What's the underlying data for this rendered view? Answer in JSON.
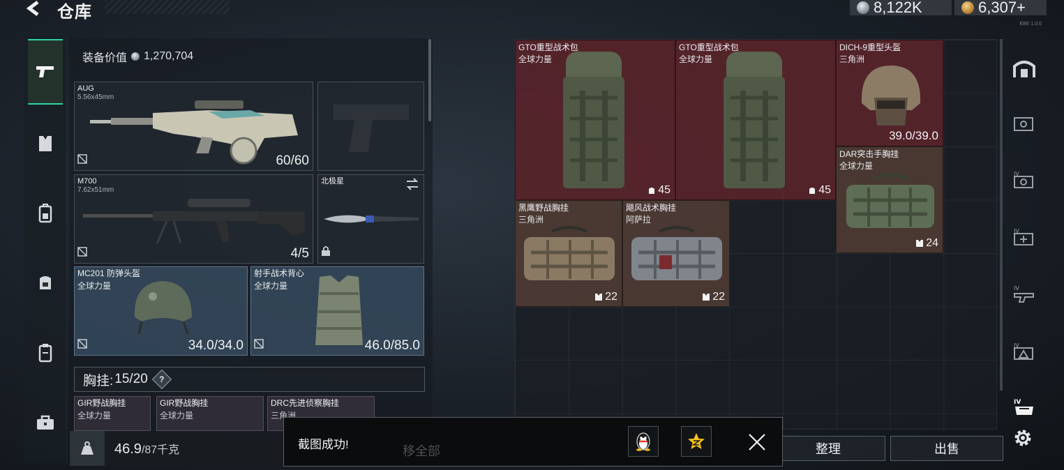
{
  "header": {
    "title": "仓库",
    "currency_silver": "8,122K",
    "currency_gold": "6,307+",
    "build_tag": "EBE 1.0.0"
  },
  "loadout": {
    "equip_value_label": "装备价值",
    "equip_value": "1,270,704",
    "primary": {
      "name": "AUG",
      "caliber": "5.56x45mm",
      "ammo": "60/60"
    },
    "secondary": {
      "name": "M700",
      "caliber": "7.62x51mm",
      "ammo": "4/5"
    },
    "melee": {
      "name": "北极星"
    },
    "helmet": {
      "name": "MC201 防弹头盔",
      "origin": "全球力量",
      "durability": "34.0/34.0"
    },
    "armor": {
      "name": "射手战术背心",
      "origin": "全球力量",
      "durability": "46.0/85.0"
    },
    "rig_label": "胸挂:",
    "rig_capacity": "15/20",
    "rig_help": "?",
    "rig_items": [
      {
        "name": "GIR野战胸挂",
        "origin": "全球力量"
      },
      {
        "name": "GIR野战胸挂",
        "origin": "全球力量"
      },
      {
        "name": "DRC先进侦察胸挂",
        "origin": "三角洲"
      }
    ],
    "weight_current": "46.9",
    "weight_max": "/87千克"
  },
  "stash": {
    "items": [
      {
        "name": "GTO重型战术包",
        "origin": "全球力量",
        "count": "45"
      },
      {
        "name": "GTO重型战术包",
        "origin": "全球力量",
        "count": "45"
      },
      {
        "name": "DICH-9重型头盔",
        "origin": "三角洲",
        "count": "39.0/39.0"
      },
      {
        "name": "DAR突击手胸挂",
        "origin": "全球力量",
        "count": "24"
      },
      {
        "name": "黑鹰野战胸挂",
        "origin": "三角洲",
        "count": "22"
      },
      {
        "name": "飓风战术胸挂",
        "origin": "阿萨拉",
        "count": "22"
      }
    ]
  },
  "actions": {
    "sort": "整理",
    "sell": "出售",
    "move_all_hidden": "移全部"
  },
  "toast": {
    "message": "截图成功!"
  },
  "colors": {
    "accent": "#2bd6a4",
    "slot_red": "#60242c",
    "slot_brown": "#543e36",
    "slot_blue": "#3a5064"
  }
}
